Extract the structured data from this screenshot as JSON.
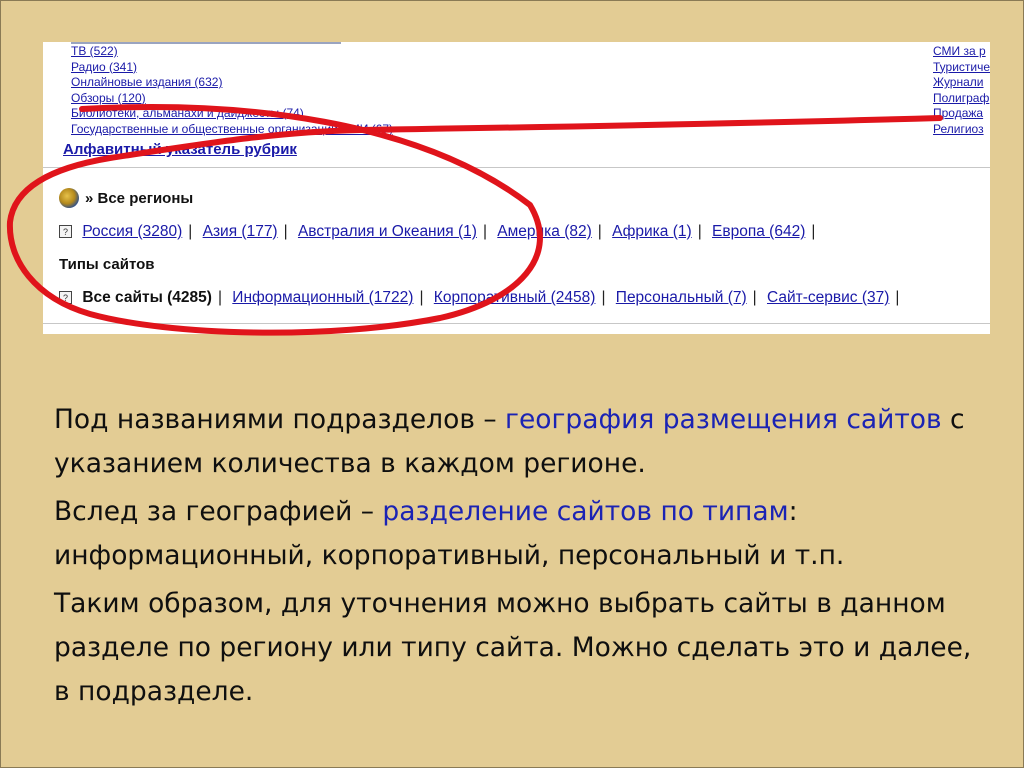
{
  "screenshot": {
    "categories_left": [
      "ТВ (522)",
      "Радио (341)",
      "Онлайновые издания (632)",
      "Обзоры (120)",
      "Библиотеки, альманахи и дайджесты (74)",
      "Государственные и общественные организации СМИ (67)"
    ],
    "categories_right": [
      "СМИ за р",
      "Туристиче",
      "Журнали",
      "Полиграф",
      "Продажа",
      "Религиоз"
    ],
    "alphabet_link": "Алфавитный указатель рубрик",
    "regions_title": "» Все регионы",
    "regions": [
      "Россия (3280)",
      "Азия (177)",
      "Австралия и Океания (1)",
      "Америка (82)",
      "Африка (1)",
      "Европа (642)"
    ],
    "types_title": "Типы сайтов",
    "types_all": "Все сайты (4285)",
    "types": [
      "Информационный (1722)",
      "Корпоративный (2458)",
      "Персональный (7)",
      "Сайт-сервис (37)"
    ],
    "separator": "|",
    "help_icon": "?"
  },
  "annotation": {
    "color": "#e0141b",
    "shape": "ellipse"
  },
  "highlight_color": "#1b23b4",
  "text": {
    "p1_a": "Под названиями подразделов – ",
    "p1_hl": "география размещения сайтов",
    "p1_b": " с указанием количества в каждом регионе.",
    "p2_a": "Вслед за географией – ",
    "p2_hl": "разделение сайтов по типам",
    "p2_b": ": информационный, корпоративный, персональный и т.п.",
    "p3": "Таким образом, для уточнения можно выбрать сайты в данном разделе по региону или типу сайта. Можно сделать это и далее, в подразделе."
  }
}
